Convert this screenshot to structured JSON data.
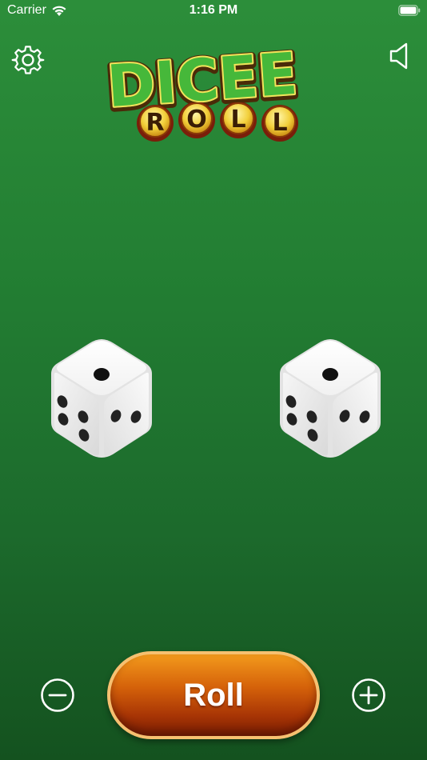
{
  "status_bar": {
    "carrier": "Carrier",
    "time": "1:16 PM",
    "wifi_icon": "wifi-icon",
    "battery_icon": "battery-icon"
  },
  "header": {
    "settings_icon": "gear-icon",
    "sound_icon": "speaker-icon"
  },
  "logo": {
    "title": "DICEE",
    "subtitle_letters": [
      "R",
      "O",
      "L",
      "L"
    ]
  },
  "dice": [
    {
      "top_face": 1,
      "left_face": 5,
      "right_face": 3
    },
    {
      "top_face": 1,
      "left_face": 5,
      "right_face": 3
    }
  ],
  "controls": {
    "minus_icon": "minus-circle-icon",
    "plus_icon": "plus-circle-icon",
    "roll_label": "Roll"
  },
  "colors": {
    "background_top": "#2c8e3a",
    "background_bottom": "#14521f",
    "roll_button_top": "#f39a1c",
    "roll_button_bottom": "#7a1e03",
    "logo_green": "#46b83a",
    "logo_outline": "#f2e45a"
  }
}
